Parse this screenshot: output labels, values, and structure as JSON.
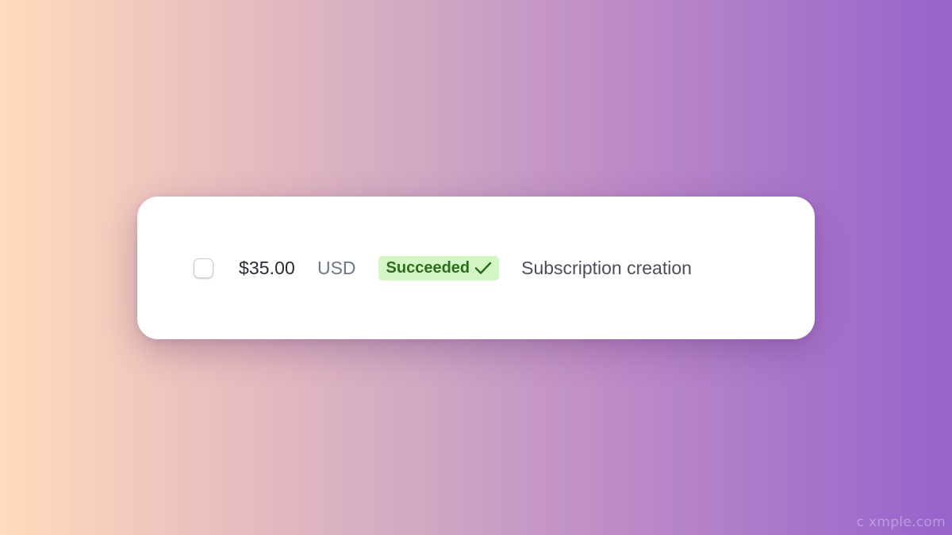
{
  "payment_row": {
    "amount": "$35.00",
    "currency": "USD",
    "status": {
      "label": "Succeeded",
      "icon": "checkmark-icon",
      "bg_color": "#d4f6c5",
      "text_color": "#2b6e1c"
    },
    "description": "Subscription creation",
    "selected": false
  },
  "background": {
    "gradient_start": "#ffdcbb",
    "gradient_end": "#9763cc"
  },
  "watermark": "c xmple.com"
}
